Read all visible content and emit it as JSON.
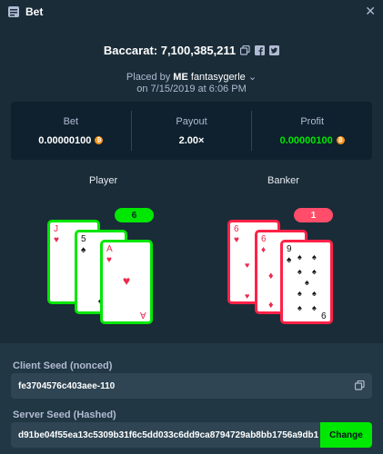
{
  "window": {
    "title": "Bet",
    "icon": "bet-slip-icon",
    "close_icon": "close-icon"
  },
  "game": {
    "title": "Baccarat: 7,100,385,211",
    "actions": [
      "copy-icon",
      "facebook-icon",
      "twitter-icon"
    ]
  },
  "placed": {
    "prefix": "Placed by",
    "badge": "ME",
    "user": "fantasygerle",
    "date": "on 7/15/2019 at 6:06 PM"
  },
  "stats": {
    "bet": {
      "label": "Bet",
      "value": "0.00000100",
      "currency_icon": "btc-icon"
    },
    "payout": {
      "label": "Payout",
      "value": "2.00×"
    },
    "profit": {
      "label": "Profit",
      "value": "0.00000100",
      "currency_icon": "btc-icon"
    }
  },
  "player": {
    "label": "Player",
    "score": "6",
    "cards": [
      {
        "rank": "J",
        "suit": "♥",
        "color": "red"
      },
      {
        "rank": "5",
        "suit": "♠",
        "color": "black"
      },
      {
        "rank": "A",
        "suit": "♥",
        "color": "red"
      }
    ]
  },
  "banker": {
    "label": "Banker",
    "score": "1",
    "cards": [
      {
        "rank": "6",
        "suit": "♥",
        "color": "red"
      },
      {
        "rank": "6",
        "suit": "♦",
        "color": "red"
      },
      {
        "rank": "9",
        "suit": "♠",
        "color": "black"
      }
    ]
  },
  "client_seed": {
    "label": "Client Seed (nonced)",
    "value": "fe3704576c403aee-110"
  },
  "server_seed": {
    "label": "Server Seed (Hashed)",
    "value": "d91be04f55ea13c5309b31f6c5dd033c6dd9ca8794729ab8bb1756a9db1",
    "button": "Change"
  },
  "colors": {
    "win": "#00e701",
    "lose": "#fe2247",
    "bg": "#1a2c38"
  }
}
